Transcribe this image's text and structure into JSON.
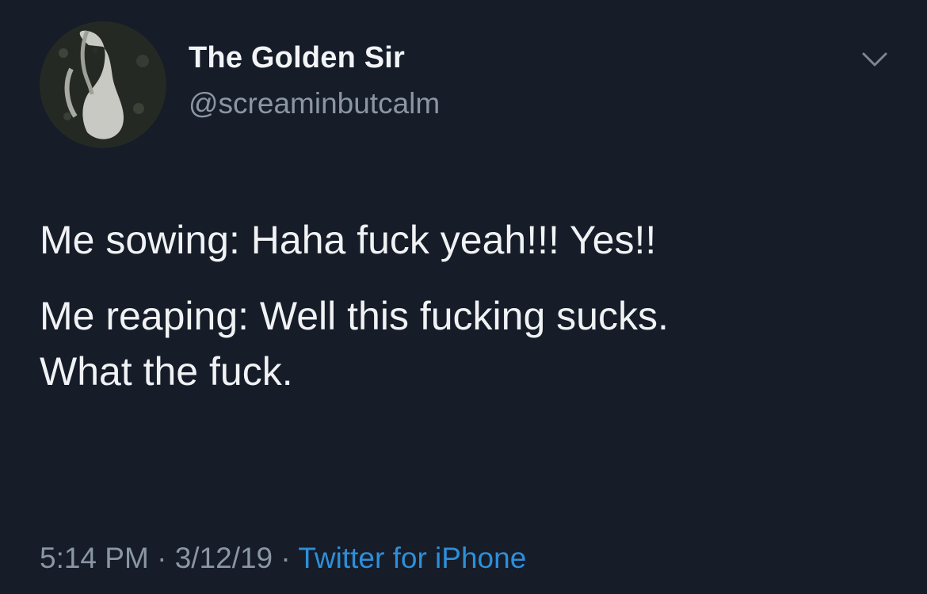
{
  "user": {
    "display_name": "The Golden Sir",
    "handle": "@screaminbutcalm"
  },
  "tweet": {
    "line_1": "Me sowing: Haha fuck yeah!!! Yes!!",
    "line_2": "Me reaping: Well this fucking sucks.\nWhat the fuck."
  },
  "meta": {
    "time": "5:14 PM",
    "separator": " · ",
    "date": "3/12/19",
    "source": "Twitter for iPhone"
  },
  "icons": {
    "avatar": "shoebill-bird-avatar",
    "menu": "chevron-down-icon"
  },
  "colors": {
    "background": "#161c28",
    "text": "#f0f2f4",
    "secondary_text": "#8a96a3",
    "link": "#2d8fd9"
  }
}
